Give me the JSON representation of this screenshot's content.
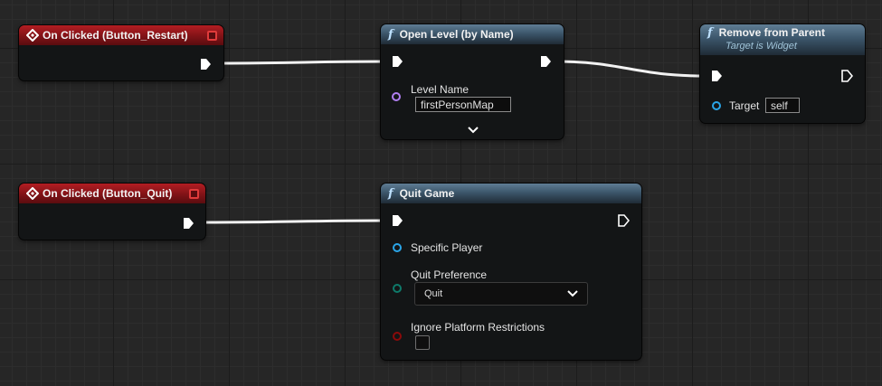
{
  "nodes": {
    "on_clicked_restart": {
      "title": "On Clicked (Button_Restart)"
    },
    "on_clicked_quit": {
      "title": "On Clicked (Button_Quit)"
    },
    "open_level": {
      "title": "Open Level (by Name)",
      "level_name_label": "Level Name",
      "level_name_value": "firstPersonMap"
    },
    "remove_from_parent": {
      "title": "Remove from Parent",
      "subtitle": "Target is Widget",
      "target_label": "Target",
      "target_value": "self"
    },
    "quit_game": {
      "title": "Quit Game",
      "specific_player_label": "Specific Player",
      "quit_preference_label": "Quit Preference",
      "quit_preference_value": "Quit",
      "ignore_platform_label": "Ignore Platform Restrictions",
      "ignore_platform_checked": false
    }
  },
  "icons": {
    "function": "f",
    "event": "event-diamond-icon",
    "exec_pin": "exec-arrow-icon",
    "delegate_pin": "delegate-square-icon",
    "chevron": "chevron-down-icon"
  },
  "colors": {
    "event_header": "#b31d22",
    "function_header": "#3c566b",
    "object_pin": "#2aa5e8",
    "name_pin": "#b07ff0",
    "enum_pin": "#0e7a6a",
    "bool_pin": "#8b0a0a",
    "delegate_pin": "#e03b3b",
    "wire": "#ffffff"
  }
}
